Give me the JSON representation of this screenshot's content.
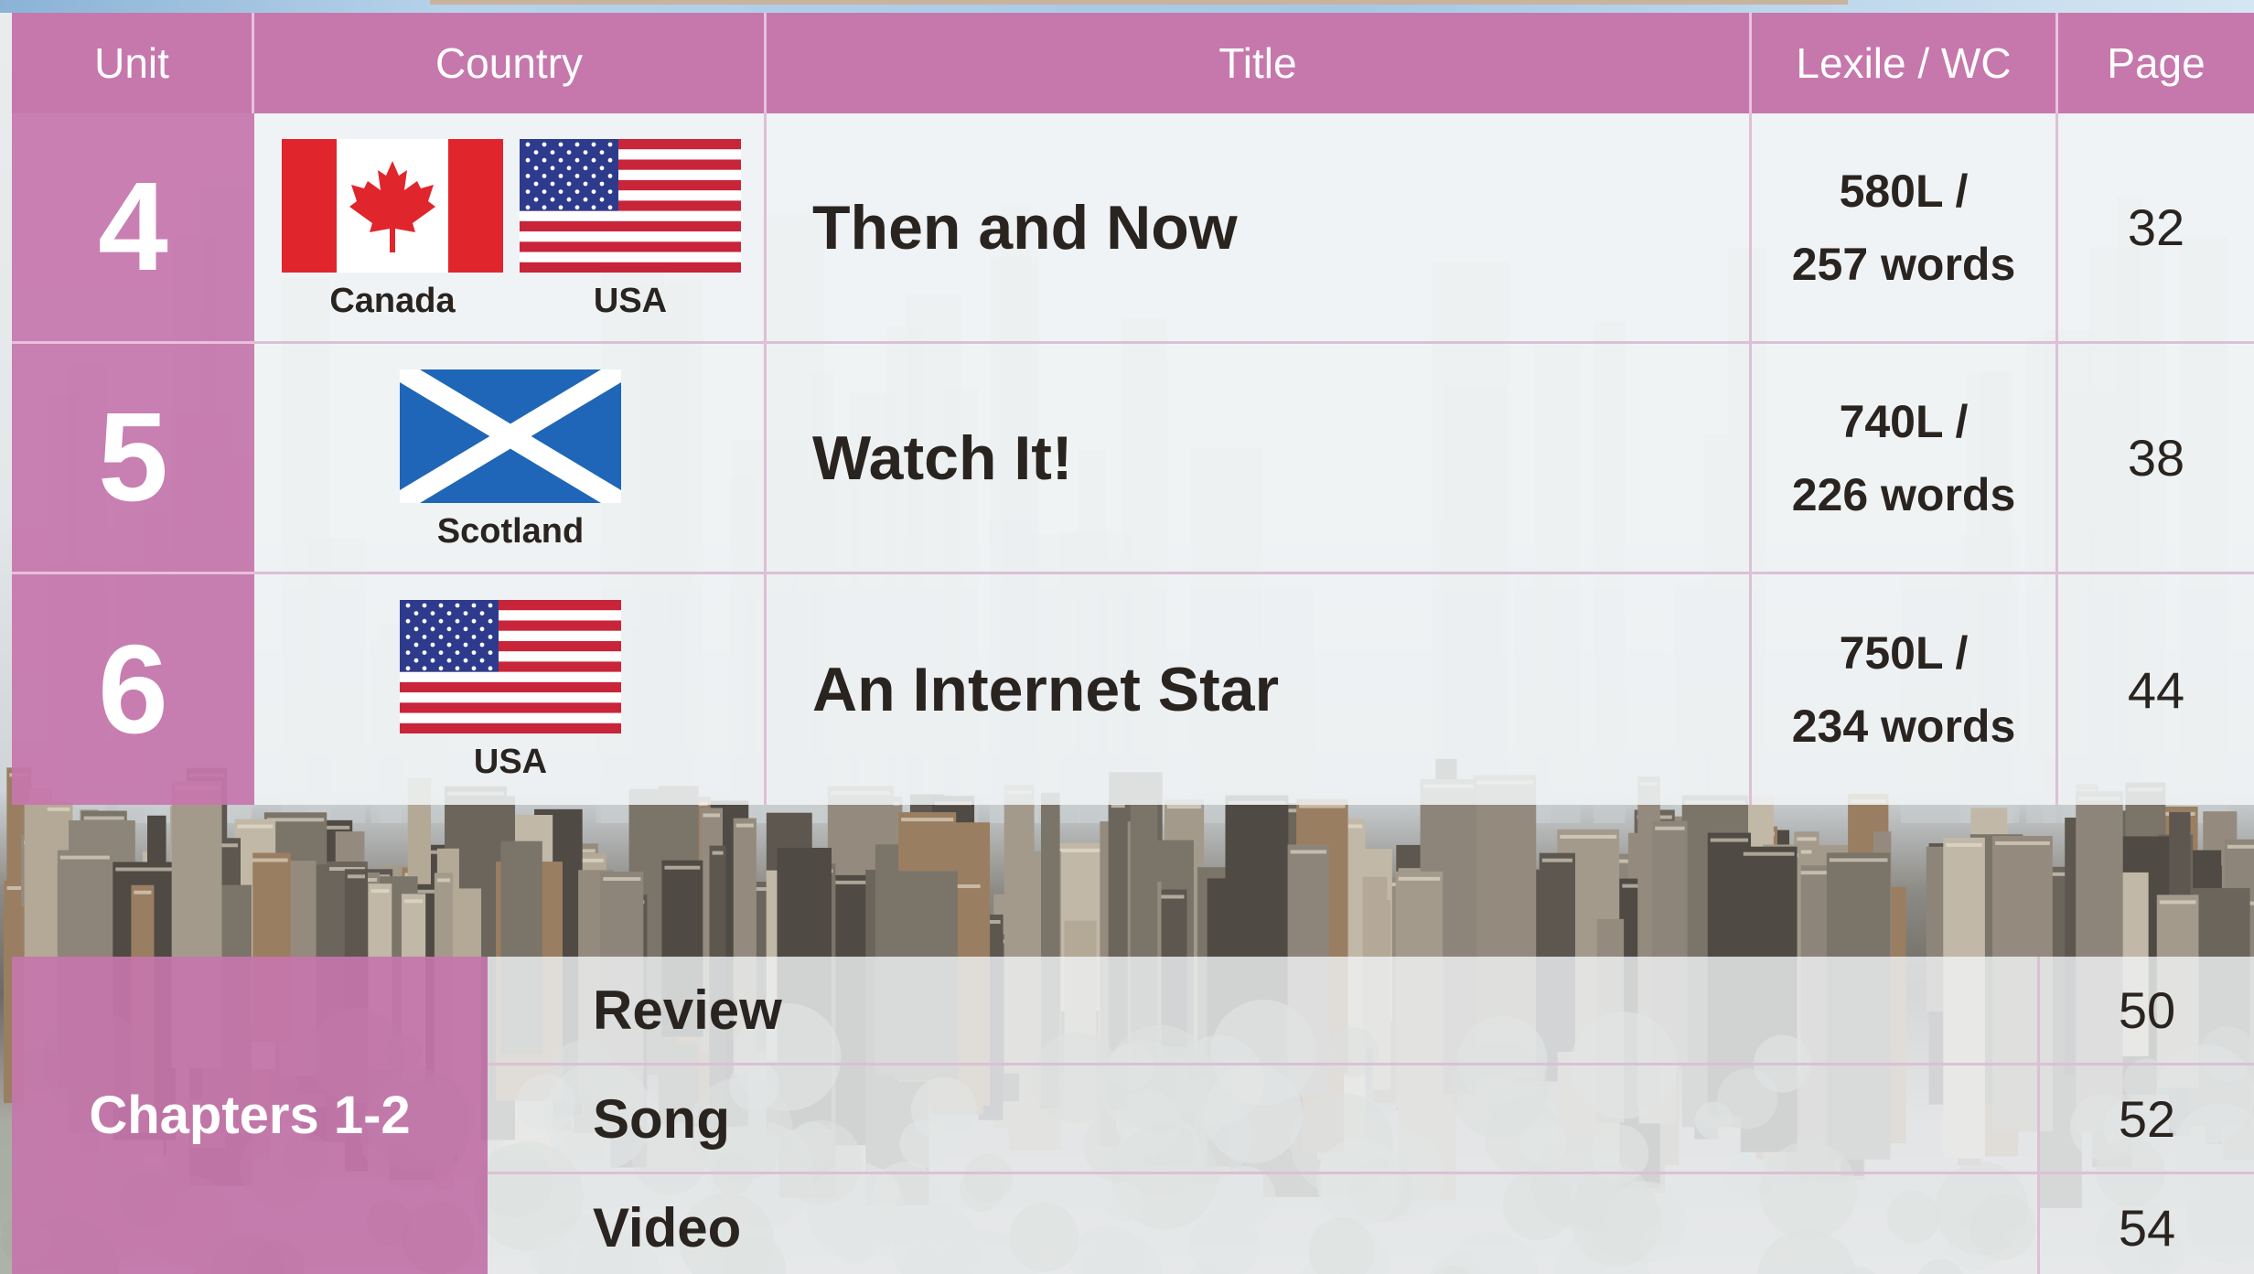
{
  "colors": {
    "header_bg": "#c678ad",
    "unit_bg": "#c676ac",
    "text_dark": "#2a2420",
    "row_bg": "#f1f4f6"
  },
  "table": {
    "headers": {
      "unit": "Unit",
      "country": "Country",
      "title": "Title",
      "lexile": "Lexile / WC",
      "page": "Page"
    },
    "rows": [
      {
        "unit": "4",
        "flags": [
          {
            "icon": "canada-flag-icon",
            "label": "Canada"
          },
          {
            "icon": "usa-flag-icon",
            "label": "USA"
          }
        ],
        "title": "Then and Now",
        "lexile": "580L /",
        "words": "257 words",
        "page": "32"
      },
      {
        "unit": "5",
        "flags": [
          {
            "icon": "scotland-flag-icon",
            "label": "Scotland"
          }
        ],
        "title": "Watch It!",
        "lexile": "740L /",
        "words": "226 words",
        "page": "38"
      },
      {
        "unit": "6",
        "flags": [
          {
            "icon": "usa-flag-icon",
            "label": "USA"
          }
        ],
        "title": "An Internet Star",
        "lexile": "750L /",
        "words": "234 words",
        "page": "44"
      }
    ]
  },
  "chapters": {
    "label": "Chapters 1-2",
    "items": [
      {
        "name": "Review",
        "page": "50"
      },
      {
        "name": "Song",
        "page": "52"
      },
      {
        "name": "Video",
        "page": "54"
      }
    ]
  }
}
